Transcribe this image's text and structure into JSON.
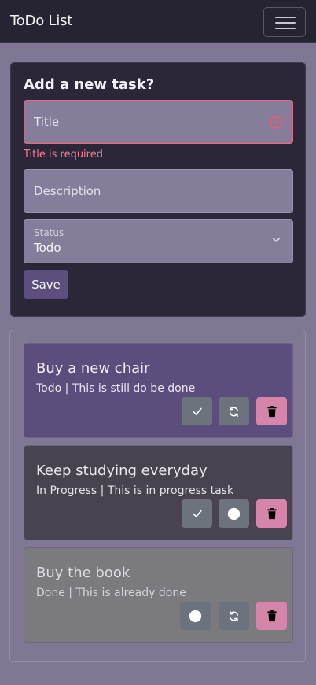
{
  "navbar": {
    "brand": "ToDo List",
    "menu_icon": "hamburger-menu-icon"
  },
  "form": {
    "heading": "Add a new task?",
    "title_placeholder": "Title",
    "title_error": "Title is required",
    "description_placeholder": "Description",
    "status_label": "Status",
    "status_value": "Todo",
    "save_label": "Save"
  },
  "tasks": [
    {
      "title": "Buy a new chair",
      "desc": "Todo | This is still do be done",
      "actions": [
        "check-icon",
        "refresh-icon",
        "trash-icon"
      ]
    },
    {
      "title": "Keep studying everyday",
      "desc": "In Progress | This is in progress task",
      "actions": [
        "check-icon",
        "circle-icon",
        "trash-icon"
      ]
    },
    {
      "title": "Buy the book",
      "desc": "Done | This is already done",
      "actions": [
        "circle-icon",
        "refresh-icon",
        "trash-icon"
      ]
    }
  ],
  "colors": {
    "todo_card": "#5b4d7c",
    "progress_card": "#48434f",
    "done_card": "#7b7a7f",
    "delete_button": "#d585aa",
    "error": "#e05d7d"
  }
}
